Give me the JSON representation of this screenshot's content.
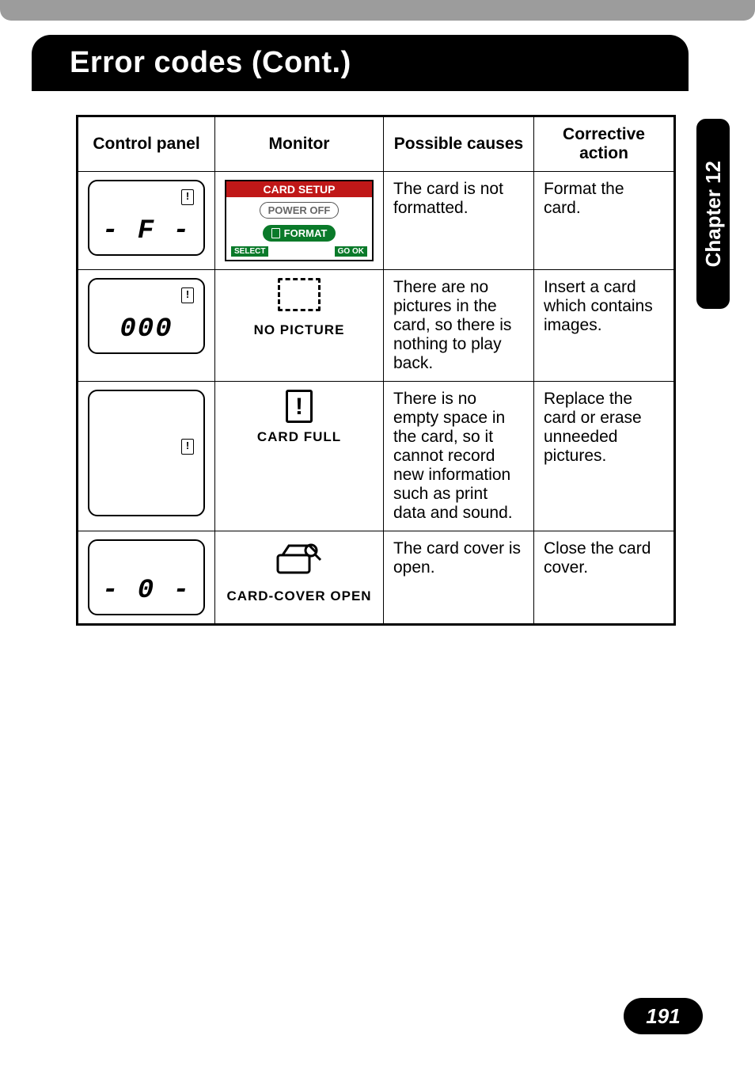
{
  "title": "Error codes (Cont.)",
  "sidetab": "Chapter 12",
  "page_number": "191",
  "table": {
    "headers": {
      "control_panel": "Control panel",
      "monitor": "Monitor",
      "causes": "Possible causes",
      "action": "Corrective action"
    },
    "rows": [
      {
        "cp_seg": "- F -",
        "cp_has_card_icon": true,
        "monitor_type": "setup",
        "monitor_setup": {
          "title": "CARD SETUP",
          "opt_power": "POWER OFF",
          "opt_format": "FORMAT",
          "foot_select": "SELECT",
          "foot_go": "GO  OK"
        },
        "cause": "The card is not formatted.",
        "action": "Format the card."
      },
      {
        "cp_seg": "000",
        "cp_has_card_icon": true,
        "monitor_type": "no_picture",
        "monitor_label": "NO  PICTURE",
        "cause": "There are no pictures in the card, so there is nothing to play back.",
        "action": "Insert a card which contains images."
      },
      {
        "cp_seg": "",
        "cp_has_card_icon": true,
        "cp_tall": true,
        "monitor_type": "card_full",
        "monitor_label": "CARD  FULL",
        "cause": "There is no empty space in the card, so it cannot record new information such as print data and sound.",
        "action": "Replace the card or erase unneeded pictures."
      },
      {
        "cp_seg": "- 0 -",
        "cp_has_card_icon": false,
        "monitor_type": "cover_open",
        "monitor_label": "CARD-COVER OPEN",
        "cause": "The card cover is open.",
        "action": "Close the card cover."
      }
    ]
  }
}
